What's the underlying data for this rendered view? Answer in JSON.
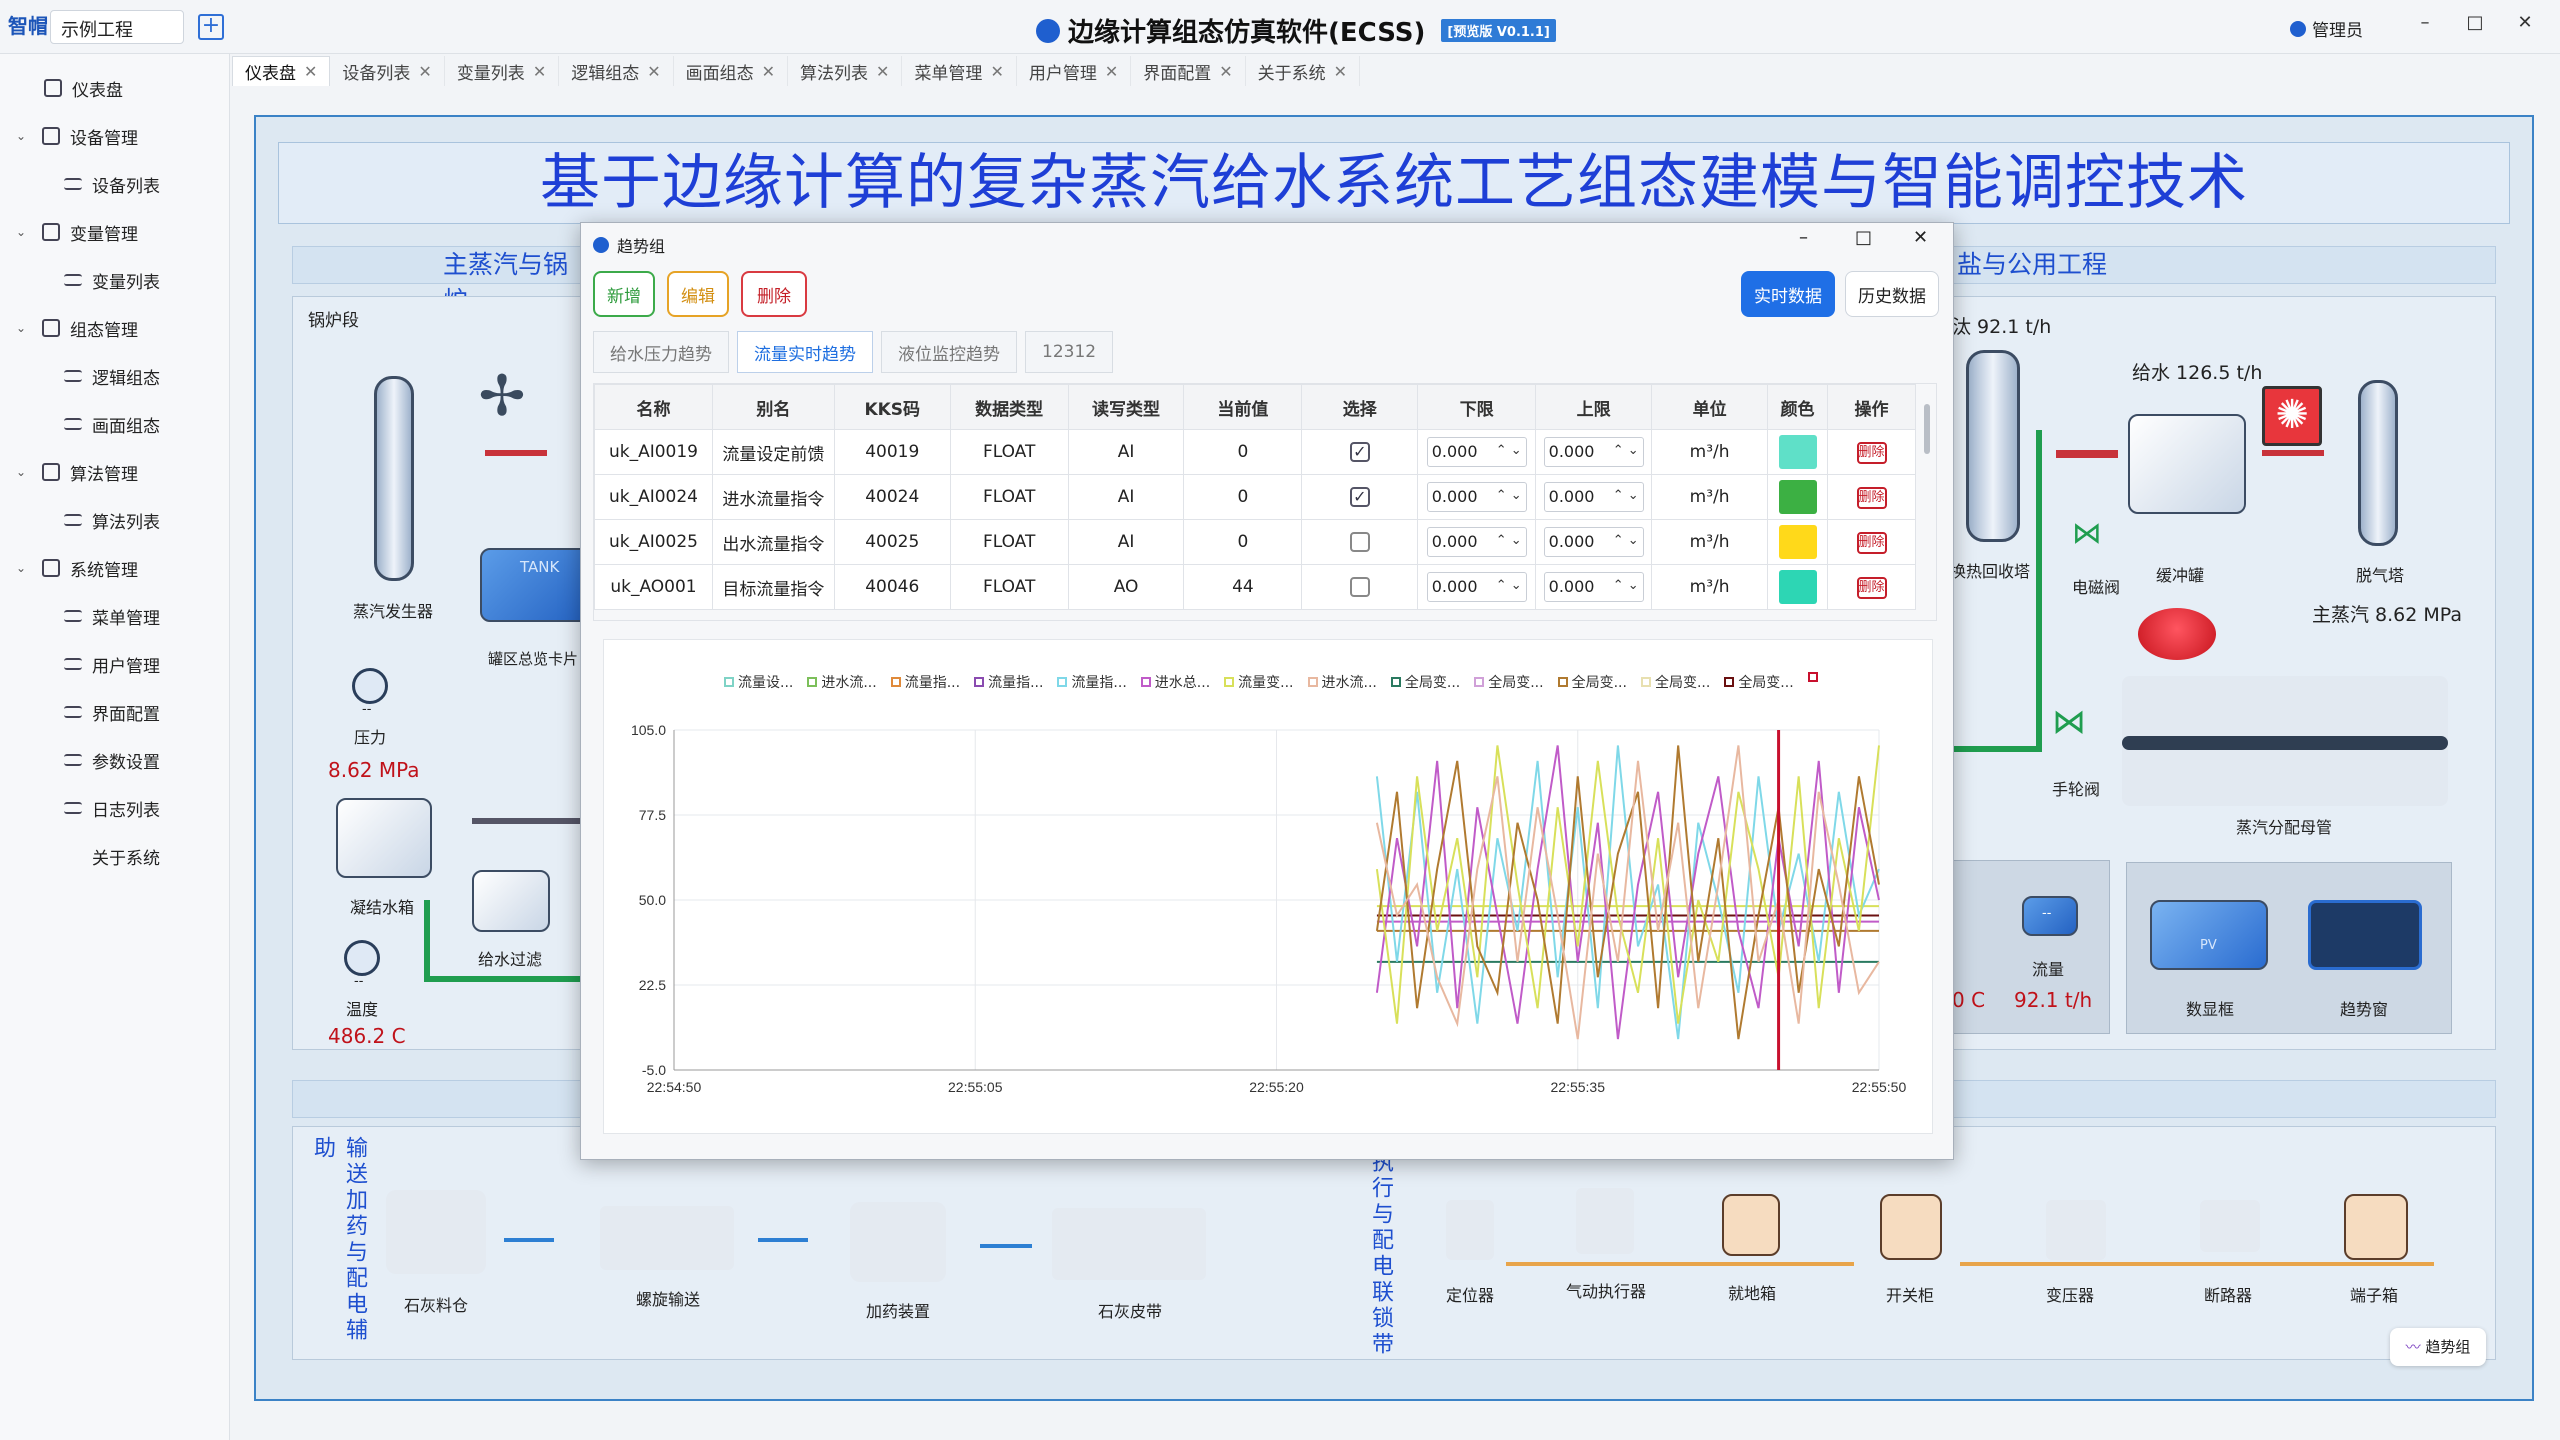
{
  "titlebar": {
    "logo": "智帽",
    "project": "示例工程",
    "app_title": "边缘计算组态仿真软件(ECSS)",
    "version": "[预览版 V0.1.1]",
    "user": "管理员"
  },
  "sidebar": {
    "items": [
      {
        "label": "仪表盘",
        "level": 0
      },
      {
        "label": "设备管理",
        "level": 0,
        "expandable": true
      },
      {
        "label": "设备列表",
        "level": 1
      },
      {
        "label": "变量管理",
        "level": 0,
        "expandable": true
      },
      {
        "label": "变量列表",
        "level": 1
      },
      {
        "label": "组态管理",
        "level": 0,
        "expandable": true
      },
      {
        "label": "逻辑组态",
        "level": 1
      },
      {
        "label": "画面组态",
        "level": 1
      },
      {
        "label": "算法管理",
        "level": 0,
        "expandable": true
      },
      {
        "label": "算法列表",
        "level": 1
      },
      {
        "label": "系统管理",
        "level": 0,
        "expandable": true
      },
      {
        "label": "菜单管理",
        "level": 1
      },
      {
        "label": "用户管理",
        "level": 1
      },
      {
        "label": "界面配置",
        "level": 1
      },
      {
        "label": "参数设置",
        "level": 1
      },
      {
        "label": "日志列表",
        "level": 1
      },
      {
        "label": "关于系统",
        "level": 1
      }
    ]
  },
  "tabs": [
    "仪表盘",
    "设备列表",
    "变量列表",
    "逻辑组态",
    "画面组态",
    "算法列表",
    "菜单管理",
    "用户管理",
    "界面配置",
    "关于系统"
  ],
  "canvas": {
    "banner": "基于边缘计算的复杂蒸汽给水系统工艺组态建模与智能调控技术",
    "section_left": "主蒸汽与锅炉",
    "section_right": "盐与公用工程",
    "boiler_label": "锅炉段",
    "steam_generator": "蒸汽发生器",
    "tank_overview": "罐区总览卡片",
    "tank_text": "TANK",
    "pressure_label": "压力",
    "pressure_value": "8.62 MPa",
    "condensate_tank": "凝结水箱",
    "feed_filter": "给水过滤",
    "temp_label": "温度",
    "temp_value": "486.2 C",
    "dash": "--",
    "right_flow_top": "汰 92.1 t/h",
    "feed_flow": "给水 126.5 t/h",
    "heat_recovery": "换热回收塔",
    "solenoid_valve": "电磁阀",
    "buffer_tank": "缓冲罐",
    "deaerator": "脱气塔",
    "main_steam": "主蒸汽 8.62 MPa",
    "hand_valve": "手轮阀",
    "steam_header": "蒸汽分配母管",
    "flow_label": "流量",
    "flow_value": "92.1 t/h",
    "temp_partial": "0 C",
    "display_box": "数显框",
    "trend_window": "趋势窗",
    "pv_text": "PV",
    "aux_vertical": "输送加药与配电辅助",
    "lime_silo": "石灰料仓",
    "screw_conveyor": "螺旋输送",
    "dosing_device": "加药装置",
    "lime_belt": "石灰皮带",
    "exec_vertical": "执行与配电联锁带",
    "positioner": "定位器",
    "pneumatic_actuator": "气动执行器",
    "local_box": "就地箱",
    "switch_cabinet": "开关柜",
    "transformer": "变压器",
    "breaker": "断路器",
    "terminal_box": "端子箱",
    "trend_group_button": "趋势组"
  },
  "dialog": {
    "title": "趋势组",
    "buttons": {
      "add": "新增",
      "edit": "编辑",
      "delete": "删除",
      "realtime": "实时数据",
      "history": "历史数据"
    },
    "subtabs": [
      "给水压力趋势",
      "流量实时趋势",
      "液位监控趋势",
      "12312"
    ],
    "active_subtab": 1,
    "columns": [
      "名称",
      "别名",
      "KKS码",
      "数据类型",
      "读写类型",
      "当前值",
      "选择",
      "下限",
      "上限",
      "单位",
      "颜色",
      "操作"
    ],
    "rows": [
      {
        "name": "uk_AI0019",
        "alias": "流量设定前馈",
        "kks": "40019",
        "dtype": "FLOAT",
        "rw": "AI",
        "value": "0",
        "checked": true,
        "low": "0.000",
        "high": "0.000",
        "unit": "m³/h",
        "color": "#5fe0c8",
        "action": "删除"
      },
      {
        "name": "uk_AI0024",
        "alias": "进水流量指令",
        "kks": "40024",
        "dtype": "FLOAT",
        "rw": "AI",
        "value": "0",
        "checked": true,
        "low": "0.000",
        "high": "0.000",
        "unit": "m³/h",
        "color": "#3cb043",
        "action": "删除"
      },
      {
        "name": "uk_AI0025",
        "alias": "出水流量指令",
        "kks": "40025",
        "dtype": "FLOAT",
        "rw": "AI",
        "value": "0",
        "checked": false,
        "low": "0.000",
        "high": "0.000",
        "unit": "m³/h",
        "color": "#ffd91a",
        "action": "删除"
      },
      {
        "name": "uk_AO001",
        "alias": "目标流量指令",
        "kks": "40046",
        "dtype": "FLOAT",
        "rw": "AO",
        "value": "44",
        "checked": false,
        "low": "0.000",
        "high": "0.000",
        "unit": "m³/h",
        "color": "#2dd6b4",
        "action": "删除"
      }
    ]
  },
  "chart_data": {
    "type": "line",
    "legend": [
      "流量设...",
      "进水流...",
      "流量指...",
      "流量指...",
      "流量指...",
      "进水总...",
      "流量变...",
      "进水流...",
      "全局变...",
      "全局变...",
      "全局变...",
      "全局变...",
      "全局变..."
    ],
    "legend_colors": [
      "#7fd3c6",
      "#7cbf5a",
      "#e08a3a",
      "#8a4bb0",
      "#7fd8e8",
      "#c05bc8",
      "#d8e05a",
      "#e8b8a0",
      "#2a7a60",
      "#d0a0d8",
      "#b07a30",
      "#e8e0b0",
      "#6a1010",
      "#c8102e"
    ],
    "x_ticks": [
      "22:54:50",
      "22:55:05",
      "22:55:20",
      "22:55:35",
      "22:55:50"
    ],
    "y_ticks": [
      "105.0",
      "77.5",
      "50.0",
      "22.5",
      "-5.0"
    ],
    "ylim": [
      -5,
      105
    ],
    "x_range_seconds": [
      0,
      60
    ],
    "series": [
      {
        "x": [
          35,
          36,
          37,
          38,
          39,
          40,
          41,
          42,
          43,
          44,
          45,
          46,
          47,
          48,
          49,
          50,
          51,
          52,
          53,
          54,
          55,
          56,
          57,
          58,
          59,
          60
        ],
        "values": [
          90,
          30,
          85,
          20,
          60,
          10,
          70,
          40,
          95,
          25,
          80,
          15,
          100,
          35,
          55,
          5,
          75,
          50,
          20,
          90,
          40,
          65,
          30,
          85,
          45,
          60
        ]
      },
      {
        "x": [
          35,
          36,
          37,
          38,
          39,
          40,
          41,
          42,
          43,
          44,
          45,
          46,
          47,
          48,
          49,
          50,
          51,
          52,
          53,
          54,
          55,
          56,
          57,
          58,
          59,
          60
        ],
        "values": [
          20,
          70,
          35,
          95,
          15,
          80,
          45,
          10,
          60,
          100,
          30,
          75,
          5,
          55,
          85,
          25,
          65,
          90,
          40,
          15,
          70,
          35,
          95,
          20,
          80,
          50
        ]
      },
      {
        "x": [
          35,
          36,
          37,
          38,
          39,
          40,
          41,
          42,
          43,
          44,
          45,
          46,
          47,
          48,
          49,
          50,
          51,
          52,
          53,
          54,
          55,
          56,
          57,
          58,
          59,
          60
        ],
        "values": [
          60,
          10,
          90,
          40,
          70,
          25,
          100,
          55,
          15,
          80,
          35,
          95,
          45,
          20,
          70,
          10,
          50,
          30,
          85,
          60,
          25,
          90,
          15,
          70,
          40,
          100
        ]
      },
      {
        "x": [
          35,
          36,
          37,
          38,
          39,
          40,
          41,
          42,
          43,
          44,
          45,
          46,
          47,
          48,
          49,
          50,
          51,
          52,
          53,
          54,
          55,
          56,
          57,
          58,
          59,
          60
        ],
        "values": [
          40,
          85,
          15,
          60,
          95,
          35,
          20,
          75,
          50,
          10,
          90,
          25,
          65,
          85,
          15,
          100,
          30,
          70,
          5,
          45,
          80,
          20,
          60,
          35,
          90,
          55
        ]
      },
      {
        "x": [
          35,
          36,
          37,
          38,
          39,
          40,
          41,
          42,
          43,
          44,
          45,
          46,
          47,
          48,
          49,
          50,
          51,
          52,
          53,
          54,
          55,
          56,
          57,
          58,
          59,
          60
        ],
        "values": [
          75,
          45,
          55,
          25,
          10,
          60,
          90,
          30,
          80,
          45,
          5,
          65,
          30,
          95,
          40,
          75,
          15,
          55,
          100,
          30,
          50,
          10,
          85,
          55,
          20,
          30
        ]
      }
    ],
    "flat_lines": [
      {
        "value": 43,
        "color": "#c05bc8"
      },
      {
        "value": 45,
        "color": "#6a1010"
      },
      {
        "value": 30,
        "color": "#2a7a60"
      },
      {
        "value": 40,
        "color": "#b07a30"
      },
      {
        "value": 48,
        "color": "#d8e05a"
      }
    ],
    "cursor_x": 55,
    "series_colors": [
      "#7fd8e8",
      "#c05bc8",
      "#d8e05a",
      "#b07a30",
      "#e8b8a0"
    ],
    "grid": true
  }
}
